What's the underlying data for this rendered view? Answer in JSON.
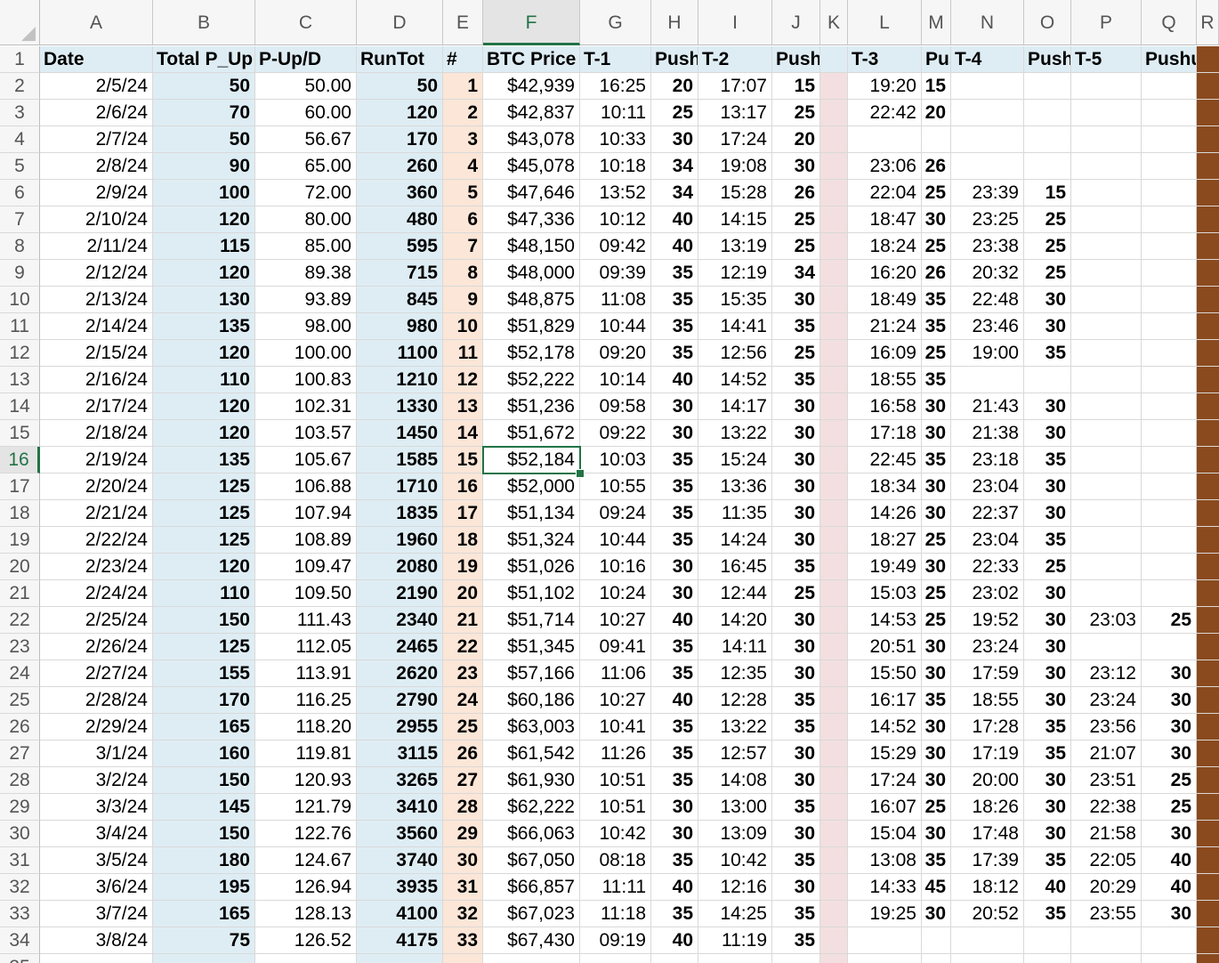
{
  "columns": [
    "A",
    "B",
    "C",
    "D",
    "E",
    "F",
    "G",
    "H",
    "I",
    "J",
    "K",
    "L",
    "M",
    "N",
    "O",
    "P",
    "Q",
    "R"
  ],
  "selected_cell": {
    "col": "F",
    "row": 16
  },
  "header_row": [
    "Date",
    "Total P_Up",
    "P-Up/D",
    "RunTot",
    "#",
    "BTC Price",
    "T-1",
    "Pushup",
    "T-2",
    "Pushup",
    "",
    "T-3",
    "Pushup",
    "T-4",
    "Pushup",
    "T-5",
    "Pushup",
    ""
  ],
  "rows": [
    [
      "2/5/24",
      "50",
      "50.00",
      "50",
      "1",
      "$42,939",
      "16:25",
      "20",
      "17:07",
      "15",
      "",
      "19:20",
      "15",
      "",
      "",
      "",
      "",
      ""
    ],
    [
      "2/6/24",
      "70",
      "60.00",
      "120",
      "2",
      "$42,837",
      "10:11",
      "25",
      "13:17",
      "25",
      "",
      "22:42",
      "20",
      "",
      "",
      "",
      "",
      ""
    ],
    [
      "2/7/24",
      "50",
      "56.67",
      "170",
      "3",
      "$43,078",
      "10:33",
      "30",
      "17:24",
      "20",
      "",
      "",
      "",
      "",
      "",
      "",
      "",
      ""
    ],
    [
      "2/8/24",
      "90",
      "65.00",
      "260",
      "4",
      "$45,078",
      "10:18",
      "34",
      "19:08",
      "30",
      "",
      "23:06",
      "26",
      "",
      "",
      "",
      "",
      ""
    ],
    [
      "2/9/24",
      "100",
      "72.00",
      "360",
      "5",
      "$47,646",
      "13:52",
      "34",
      "15:28",
      "26",
      "",
      "22:04",
      "25",
      "23:39",
      "15",
      "",
      "",
      ""
    ],
    [
      "2/10/24",
      "120",
      "80.00",
      "480",
      "6",
      "$47,336",
      "10:12",
      "40",
      "14:15",
      "25",
      "",
      "18:47",
      "30",
      "23:25",
      "25",
      "",
      "",
      ""
    ],
    [
      "2/11/24",
      "115",
      "85.00",
      "595",
      "7",
      "$48,150",
      "09:42",
      "40",
      "13:19",
      "25",
      "",
      "18:24",
      "25",
      "23:38",
      "25",
      "",
      "",
      ""
    ],
    [
      "2/12/24",
      "120",
      "89.38",
      "715",
      "8",
      "$48,000",
      "09:39",
      "35",
      "12:19",
      "34",
      "",
      "16:20",
      "26",
      "20:32",
      "25",
      "",
      "",
      ""
    ],
    [
      "2/13/24",
      "130",
      "93.89",
      "845",
      "9",
      "$48,875",
      "11:08",
      "35",
      "15:35",
      "30",
      "",
      "18:49",
      "35",
      "22:48",
      "30",
      "",
      "",
      ""
    ],
    [
      "2/14/24",
      "135",
      "98.00",
      "980",
      "10",
      "$51,829",
      "10:44",
      "35",
      "14:41",
      "35",
      "",
      "21:24",
      "35",
      "23:46",
      "30",
      "",
      "",
      ""
    ],
    [
      "2/15/24",
      "120",
      "100.00",
      "1100",
      "11",
      "$52,178",
      "09:20",
      "35",
      "12:56",
      "25",
      "",
      "16:09",
      "25",
      "19:00",
      "35",
      "",
      "",
      ""
    ],
    [
      "2/16/24",
      "110",
      "100.83",
      "1210",
      "12",
      "$52,222",
      "10:14",
      "40",
      "14:52",
      "35",
      "",
      "18:55",
      "35",
      "",
      "",
      "",
      "",
      ""
    ],
    [
      "2/17/24",
      "120",
      "102.31",
      "1330",
      "13",
      "$51,236",
      "09:58",
      "30",
      "14:17",
      "30",
      "",
      "16:58",
      "30",
      "21:43",
      "30",
      "",
      "",
      ""
    ],
    [
      "2/18/24",
      "120",
      "103.57",
      "1450",
      "14",
      "$51,672",
      "09:22",
      "30",
      "13:22",
      "30",
      "",
      "17:18",
      "30",
      "21:38",
      "30",
      "",
      "",
      ""
    ],
    [
      "2/19/24",
      "135",
      "105.67",
      "1585",
      "15",
      "$52,184",
      "10:03",
      "35",
      "15:24",
      "30",
      "",
      "22:45",
      "35",
      "23:18",
      "35",
      "",
      "",
      ""
    ],
    [
      "2/20/24",
      "125",
      "106.88",
      "1710",
      "16",
      "$52,000",
      "10:55",
      "35",
      "13:36",
      "30",
      "",
      "18:34",
      "30",
      "23:04",
      "30",
      "",
      "",
      ""
    ],
    [
      "2/21/24",
      "125",
      "107.94",
      "1835",
      "17",
      "$51,134",
      "09:24",
      "35",
      "11:35",
      "30",
      "",
      "14:26",
      "30",
      "22:37",
      "30",
      "",
      "",
      ""
    ],
    [
      "2/22/24",
      "125",
      "108.89",
      "1960",
      "18",
      "$51,324",
      "10:44",
      "35",
      "14:24",
      "30",
      "",
      "18:27",
      "25",
      "23:04",
      "35",
      "",
      "",
      ""
    ],
    [
      "2/23/24",
      "120",
      "109.47",
      "2080",
      "19",
      "$51,026",
      "10:16",
      "30",
      "16:45",
      "35",
      "",
      "19:49",
      "30",
      "22:33",
      "25",
      "",
      "",
      ""
    ],
    [
      "2/24/24",
      "110",
      "109.50",
      "2190",
      "20",
      "$51,102",
      "10:24",
      "30",
      "12:44",
      "25",
      "",
      "15:03",
      "25",
      "23:02",
      "30",
      "",
      "",
      ""
    ],
    [
      "2/25/24",
      "150",
      "111.43",
      "2340",
      "21",
      "$51,714",
      "10:27",
      "40",
      "14:20",
      "30",
      "",
      "14:53",
      "25",
      "19:52",
      "30",
      "23:03",
      "25",
      ""
    ],
    [
      "2/26/24",
      "125",
      "112.05",
      "2465",
      "22",
      "$51,345",
      "09:41",
      "35",
      "14:11",
      "30",
      "",
      "20:51",
      "30",
      "23:24",
      "30",
      "",
      "",
      ""
    ],
    [
      "2/27/24",
      "155",
      "113.91",
      "2620",
      "23",
      "$57,166",
      "11:06",
      "35",
      "12:35",
      "30",
      "",
      "15:50",
      "30",
      "17:59",
      "30",
      "23:12",
      "30",
      ""
    ],
    [
      "2/28/24",
      "170",
      "116.25",
      "2790",
      "24",
      "$60,186",
      "10:27",
      "40",
      "12:28",
      "35",
      "",
      "16:17",
      "35",
      "18:55",
      "30",
      "23:24",
      "30",
      ""
    ],
    [
      "2/29/24",
      "165",
      "118.20",
      "2955",
      "25",
      "$63,003",
      "10:41",
      "35",
      "13:22",
      "35",
      "",
      "14:52",
      "30",
      "17:28",
      "35",
      "23:56",
      "30",
      ""
    ],
    [
      "3/1/24",
      "160",
      "119.81",
      "3115",
      "26",
      "$61,542",
      "11:26",
      "35",
      "12:57",
      "30",
      "",
      "15:29",
      "30",
      "17:19",
      "35",
      "21:07",
      "30",
      ""
    ],
    [
      "3/2/24",
      "150",
      "120.93",
      "3265",
      "27",
      "$61,930",
      "10:51",
      "35",
      "14:08",
      "30",
      "",
      "17:24",
      "30",
      "20:00",
      "30",
      "23:51",
      "25",
      ""
    ],
    [
      "3/3/24",
      "145",
      "121.79",
      "3410",
      "28",
      "$62,222",
      "10:51",
      "30",
      "13:00",
      "35",
      "",
      "16:07",
      "25",
      "18:26",
      "30",
      "22:38",
      "25",
      ""
    ],
    [
      "3/4/24",
      "150",
      "122.76",
      "3560",
      "29",
      "$66,063",
      "10:42",
      "30",
      "13:09",
      "30",
      "",
      "15:04",
      "30",
      "17:48",
      "30",
      "21:58",
      "30",
      ""
    ],
    [
      "3/5/24",
      "180",
      "124.67",
      "3740",
      "30",
      "$67,050",
      "08:18",
      "35",
      "10:42",
      "35",
      "",
      "13:08",
      "35",
      "17:39",
      "35",
      "22:05",
      "40",
      ""
    ],
    [
      "3/6/24",
      "195",
      "126.94",
      "3935",
      "31",
      "$66,857",
      "11:11",
      "40",
      "12:16",
      "30",
      "",
      "14:33",
      "45",
      "18:12",
      "40",
      "20:29",
      "40",
      ""
    ],
    [
      "3/7/24",
      "165",
      "128.13",
      "4100",
      "32",
      "$67,023",
      "11:18",
      "35",
      "14:25",
      "35",
      "",
      "19:25",
      "30",
      "20:52",
      "35",
      "23:55",
      "30",
      ""
    ],
    [
      "3/8/24",
      "75",
      "126.52",
      "4175",
      "33",
      "$67,430",
      "09:19",
      "40",
      "11:19",
      "35",
      "",
      "",
      "",
      "",
      "",
      "",
      "",
      ""
    ]
  ],
  "colors": {
    "header_fill": "#deedf4",
    "blue_column_fill": "#deedf4",
    "orange_column_fill": "#fbe6d7",
    "pink_column_fill": "#f3dfdf",
    "brown_column_fill": "#8b4a1e",
    "selection_accent": "#217346"
  }
}
